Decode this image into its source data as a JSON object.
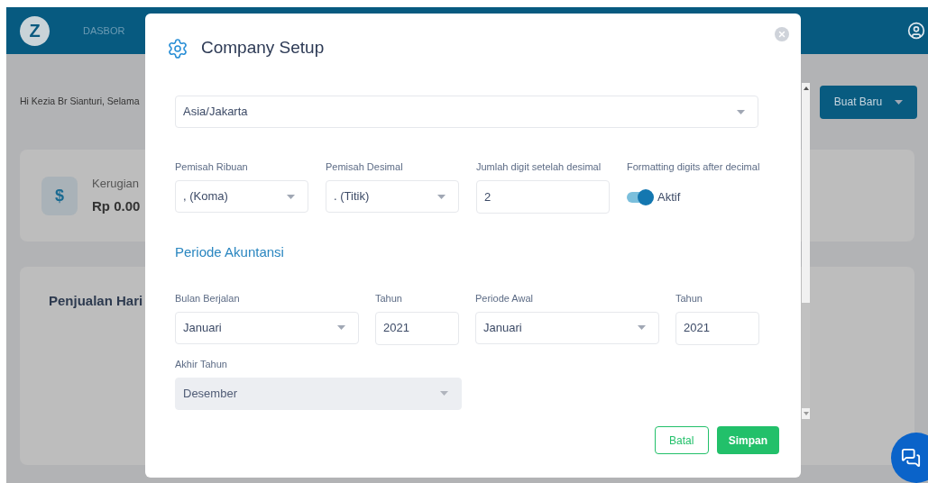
{
  "app": {
    "logo": "Z",
    "nav": [
      {
        "label": "DASBOR",
        "selected": false
      }
    ],
    "greeting": "Hi Kezia Br Sianturi, Selama",
    "create_button": "Buat Baru",
    "summary_card": {
      "symbol": "$",
      "title": "Kerugian",
      "value": "Rp 0.00"
    },
    "sales_card": {
      "title": "Penjualan Hari"
    }
  },
  "modal": {
    "title": "Company Setup",
    "timezone": {
      "value": "Asia/Jakarta",
      "kind": "select"
    },
    "row_1": [
      {
        "label": "Pemisah Ribuan",
        "value": ", (Koma)",
        "kind": "select"
      },
      {
        "label": "Pemisah Desimal",
        "value": ". (Titik)",
        "kind": "select"
      },
      {
        "label": "Jumlah digit setelah desimal",
        "value": "2",
        "kind": "input"
      },
      {
        "label": "Formatting digits after decimal",
        "value": "Aktif",
        "kind": "toggle",
        "on": true
      }
    ],
    "section_title": "Periode Akuntansi",
    "row_2": [
      {
        "label": "Bulan Berjalan",
        "value": "Januari",
        "kind": "select"
      },
      {
        "label": "Tahun",
        "value": "2021",
        "kind": "input"
      },
      {
        "label": "Periode Awal",
        "value": "Januari",
        "kind": "select"
      },
      {
        "label": "Tahun",
        "value": "2021",
        "kind": "input"
      }
    ],
    "year_end": {
      "label": "Akhir Tahun",
      "value": "Desember",
      "kind": "select",
      "disabled": true
    },
    "buttons": [
      {
        "label": "Batal",
        "kind": "secondary"
      },
      {
        "label": "Simpan",
        "kind": "primary"
      }
    ]
  }
}
